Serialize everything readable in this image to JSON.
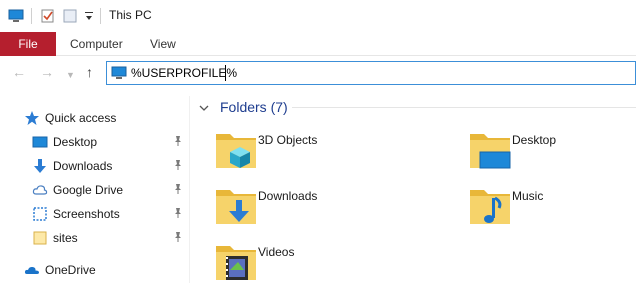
{
  "window": {
    "title": "This PC"
  },
  "ribbon": {
    "tabs": [
      "File",
      "Computer",
      "View"
    ]
  },
  "address_bar": {
    "value": "%USERPROFILE%",
    "icon": "computer-icon"
  },
  "nav_pane": {
    "items": [
      {
        "label": "Quick access",
        "icon": "star-icon",
        "pinned": false
      },
      {
        "label": "Desktop",
        "icon": "desktop-icon",
        "pinned": true
      },
      {
        "label": "Downloads",
        "icon": "download-arrow-icon",
        "pinned": true
      },
      {
        "label": "Google Drive",
        "icon": "cloud-icon",
        "pinned": true
      },
      {
        "label": "Screenshots",
        "icon": "screenshot-icon",
        "pinned": true
      },
      {
        "label": "sites",
        "icon": "folder-icon",
        "pinned": true
      },
      {
        "label": "OneDrive",
        "icon": "onedrive-cloud-icon",
        "pinned": false
      }
    ]
  },
  "content": {
    "group_title": "Folders (7)",
    "folders": [
      {
        "label": "3D Objects",
        "icon": "3d-objects-icon"
      },
      {
        "label": "Desktop",
        "icon": "desktop-folder-icon"
      },
      {
        "label": "Downloads",
        "icon": "downloads-folder-icon"
      },
      {
        "label": "Music",
        "icon": "music-folder-icon"
      },
      {
        "label": "Videos",
        "icon": "videos-folder-icon"
      }
    ]
  },
  "colors": {
    "file_tab": "#b51f2e",
    "accent": "#3c8fd8",
    "group_title": "#1e3d8f",
    "folder": "#f2c94c"
  }
}
